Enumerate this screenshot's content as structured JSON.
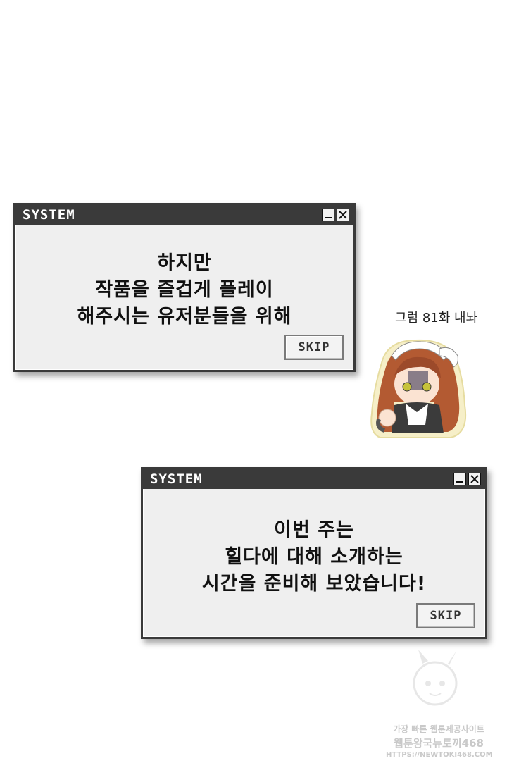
{
  "dialogs": [
    {
      "title": "SYSTEM",
      "lines": [
        "하지만",
        "작품을 즐겁게 플레이",
        "해주시는 유저분들을 위해"
      ],
      "skip_label": "SKIP"
    },
    {
      "title": "SYSTEM",
      "lines": [
        "이번 주는",
        "힐다에 대해 소개하는",
        "시간을 준비해 보았습니다!"
      ],
      "skip_label": "SKIP"
    }
  ],
  "side_note": "그럼 81화 내놔",
  "watermark": {
    "line1": "가장 빠른 웹툰제공사이트",
    "line2": "웹툰왕국뉴토끼468",
    "line3": "HTTPS://NEWTOKI468.COM"
  },
  "colors": {
    "titlebar": "#3a3a3a",
    "dialog_bg": "#efefef",
    "text": "#111111"
  },
  "icons": [
    "minimize-icon",
    "close-icon"
  ]
}
